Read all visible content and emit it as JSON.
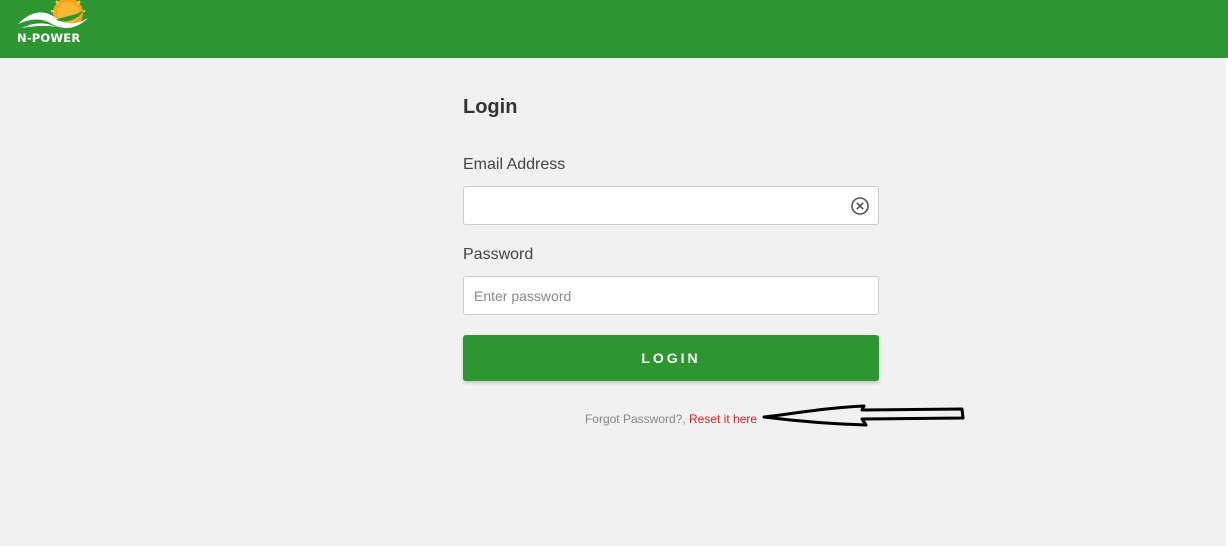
{
  "header": {
    "logo_text": "N-POWER",
    "background_color": "#2e9631"
  },
  "form": {
    "title": "Login",
    "email_label": "Email Address",
    "email_value": "",
    "email_placeholder": "",
    "email_clear_icon": "clear-circle-x-icon",
    "password_label": "Password",
    "password_value": "",
    "password_placeholder": "Enter password",
    "login_button_label": "LOGIN",
    "forgot_text": "Forgot Password?, ",
    "reset_link_text": "Reset it here"
  },
  "annotation": {
    "icon": "hand-drawn-arrow-icon",
    "color": "#000000"
  },
  "colors": {
    "accent": "#2e9631",
    "link": "#e02020",
    "page_background": "#f1f1f1"
  }
}
